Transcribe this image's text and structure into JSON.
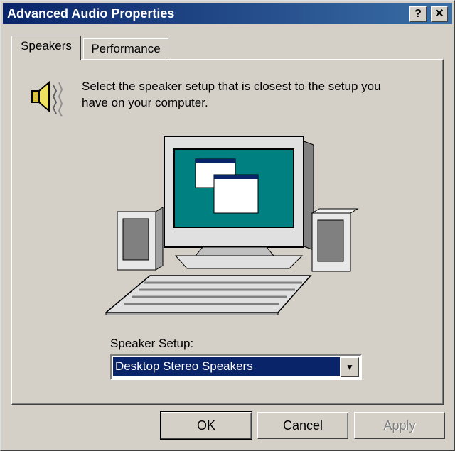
{
  "window": {
    "title": "Advanced Audio Properties",
    "help_label": "?",
    "close_label": "✕"
  },
  "tabs": [
    {
      "label": "Speakers"
    },
    {
      "label": "Performance"
    }
  ],
  "speakers": {
    "description": "Select the speaker setup that is closest to the setup you have on your computer.",
    "setup_label": "Speaker Setup:",
    "setup_value": "Desktop Stereo Speakers"
  },
  "buttons": {
    "ok": "OK",
    "cancel": "Cancel",
    "apply": "Apply"
  },
  "colors": {
    "title_start": "#0a246a",
    "title_end": "#3a6ea5",
    "screen": "#008080",
    "face": "#d4d0c8"
  }
}
